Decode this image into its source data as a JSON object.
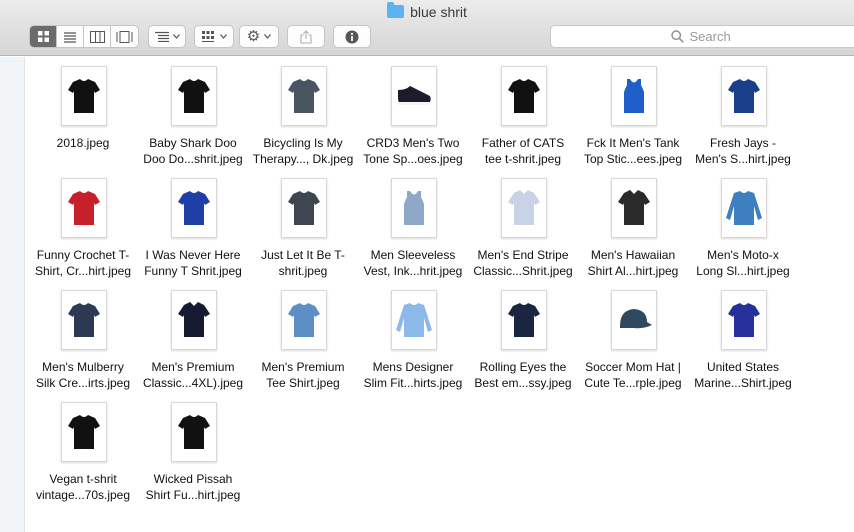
{
  "window": {
    "title": "blue shrit"
  },
  "toolbar": {
    "view_buttons": [
      "icon-view",
      "list-view",
      "column-view",
      "gallery-view"
    ],
    "search_placeholder": "Search"
  },
  "files": [
    {
      "line1": "2018.jpeg",
      "line2": "",
      "shirt": "#111111",
      "icon": "t-shirt"
    },
    {
      "line1": "Baby Shark Doo",
      "line2": "Doo Do...shrit.jpeg",
      "shirt": "#111111",
      "icon": "t-shirt"
    },
    {
      "line1": "Bicycling Is My",
      "line2": "Therapy..., Dk.jpeg",
      "shirt": "#4a5561",
      "icon": "t-shirt"
    },
    {
      "line1": "CRD3 Men's Two",
      "line2": "Tone Sp...oes.jpeg",
      "shirt": "#1c1c2a",
      "icon": "shoe"
    },
    {
      "line1": "Father of CATS",
      "line2": "tee t-shrit.jpeg",
      "shirt": "#111111",
      "icon": "t-shirt"
    },
    {
      "line1": "Fck It Men's Tank",
      "line2": "Top Stic...ees.jpeg",
      "shirt": "#1f5fc9",
      "icon": "tank"
    },
    {
      "line1": "Fresh Jays -",
      "line2": "Men's S...hirt.jpeg",
      "shirt": "#1a3f8a",
      "icon": "t-shirt"
    },
    {
      "line1": "Funny Crochet T-",
      "line2": "Shirt, Cr...hirt.jpeg",
      "shirt": "#c8202a",
      "icon": "t-shirt"
    },
    {
      "line1": "I Was Never Here",
      "line2": "Funny T Shrit.jpeg",
      "shirt": "#1f3fa8",
      "icon": "t-shirt"
    },
    {
      "line1": "Just Let It Be T-",
      "line2": "shrit.jpeg",
      "shirt": "#3e4650",
      "icon": "t-shirt"
    },
    {
      "line1": "Men Sleeveless",
      "line2": "Vest, Ink...hrit.jpeg",
      "shirt": "#8fa8c8",
      "icon": "tank"
    },
    {
      "line1": "Men's End Stripe",
      "line2": "Classic...Shrit.jpeg",
      "shirt": "#c9d2e6",
      "icon": "dress"
    },
    {
      "line1": "Men's Hawaiian",
      "line2": "Shirt Al...hirt.jpeg",
      "shirt": "#2a2a2a",
      "icon": "dress"
    },
    {
      "line1": "Men's Moto-x",
      "line2": "Long Sl...hirt.jpeg",
      "shirt": "#3d7fbf",
      "icon": "long"
    },
    {
      "line1": "Men's Mulberry",
      "line2": "Silk Cre...irts.jpeg",
      "shirt": "#2b3a52",
      "icon": "t-shirt"
    },
    {
      "line1": "Men's Premium",
      "line2": "Classic...4XL).jpeg",
      "shirt": "#151a30",
      "icon": "dress"
    },
    {
      "line1": "Men's Premium",
      "line2": "Tee Shirt.jpeg",
      "shirt": "#5c90c4",
      "icon": "t-shirt"
    },
    {
      "line1": "Mens Designer",
      "line2": "Slim Fit...hirts.jpeg",
      "shirt": "#8db8ea",
      "icon": "long"
    },
    {
      "line1": "Rolling Eyes the",
      "line2": "Best em...ssy.jpeg",
      "shirt": "#1a2540",
      "icon": "t-shirt"
    },
    {
      "line1": "Soccer Mom Hat |",
      "line2": "Cute Te...rple.jpeg",
      "shirt": "#2f4a60",
      "icon": "hat"
    },
    {
      "line1": "United States",
      "line2": "Marine...Shirt.jpeg",
      "shirt": "#25309a",
      "icon": "t-shirt"
    },
    {
      "line1": "Vegan t-shrit",
      "line2": "vintage...70s.jpeg",
      "shirt": "#111111",
      "icon": "t-shirt"
    },
    {
      "line1": "Wicked Pissah",
      "line2": "Shirt Fu...hirt.jpeg",
      "shirt": "#111111",
      "icon": "t-shirt"
    }
  ]
}
